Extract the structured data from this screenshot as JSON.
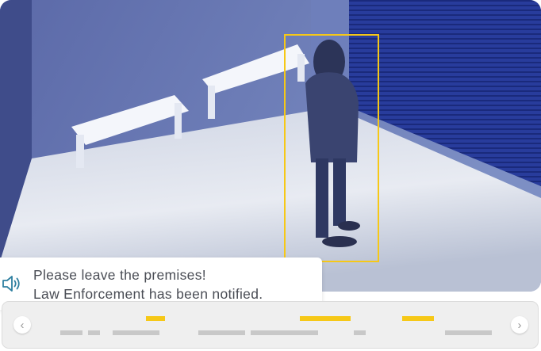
{
  "alert": {
    "line1": "Please leave the premises!",
    "line2": "Law Enforcement has been notified.",
    "icon": "speaker-volume-icon",
    "icon_color": "#2e7fa0"
  },
  "timeline": {
    "prev_icon": "chevron-left-icon",
    "next_icon": "chevron-right-icon",
    "prev_glyph": "‹",
    "next_glyph": "›",
    "event_color": "#f6c817",
    "segment_color": "#c8c8c8"
  },
  "colors": {
    "detection_box": "#f6c817",
    "video_tint": "#3c4f9a"
  }
}
